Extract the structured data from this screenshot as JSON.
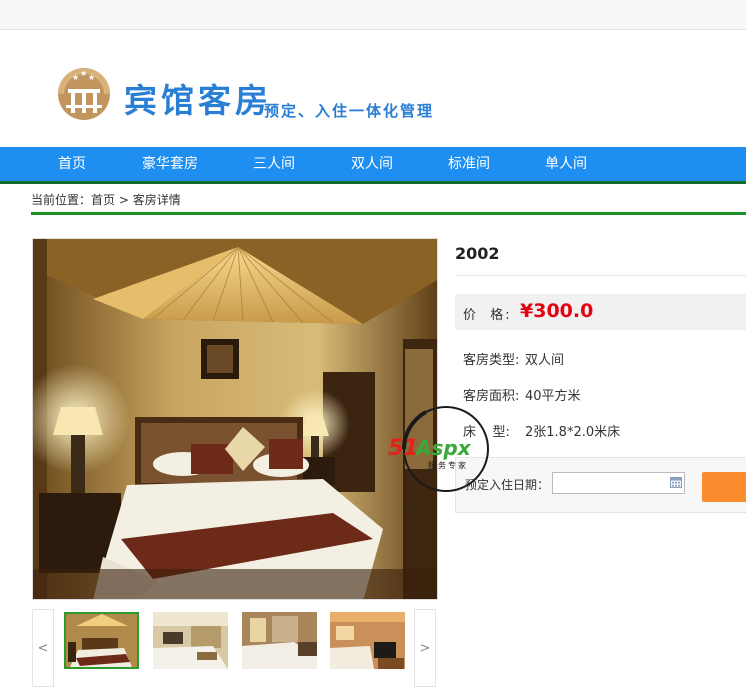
{
  "header": {
    "logo_title": "宾馆客房",
    "logo_slogan": "预定、入住一体化管理"
  },
  "nav": {
    "items": [
      "首页",
      "豪华套房",
      "三人间",
      "双人间",
      "标准间",
      "单人间"
    ]
  },
  "breadcrumb": {
    "prefix": "当前位置：",
    "home": "首页",
    "separator": " > ",
    "current": "客房详情"
  },
  "room": {
    "title": "2002",
    "price_label": "价  格:",
    "price": "¥300.0",
    "type_label": "客房类型:",
    "type_value": "双人间",
    "area_label": "客房面积:",
    "area_value": "40平方米",
    "bed_label": "床    型:",
    "bed_value": "2张1.8*2.0米床"
  },
  "booking": {
    "date_label": "预定入住日期：",
    "date_value": ""
  },
  "gallery": {
    "prev": "<",
    "next": ">",
    "active_index": 0,
    "thumb_count": 4
  },
  "watermark": {
    "brand": "51Aspx",
    "tagline": "服务专家"
  },
  "colors": {
    "nav_bg": "#1e8ff0",
    "accent_green": "#1a8f26",
    "price_red": "#e50012",
    "brand_blue": "#2a7fd4",
    "book_orange": "#fb8d2f"
  }
}
